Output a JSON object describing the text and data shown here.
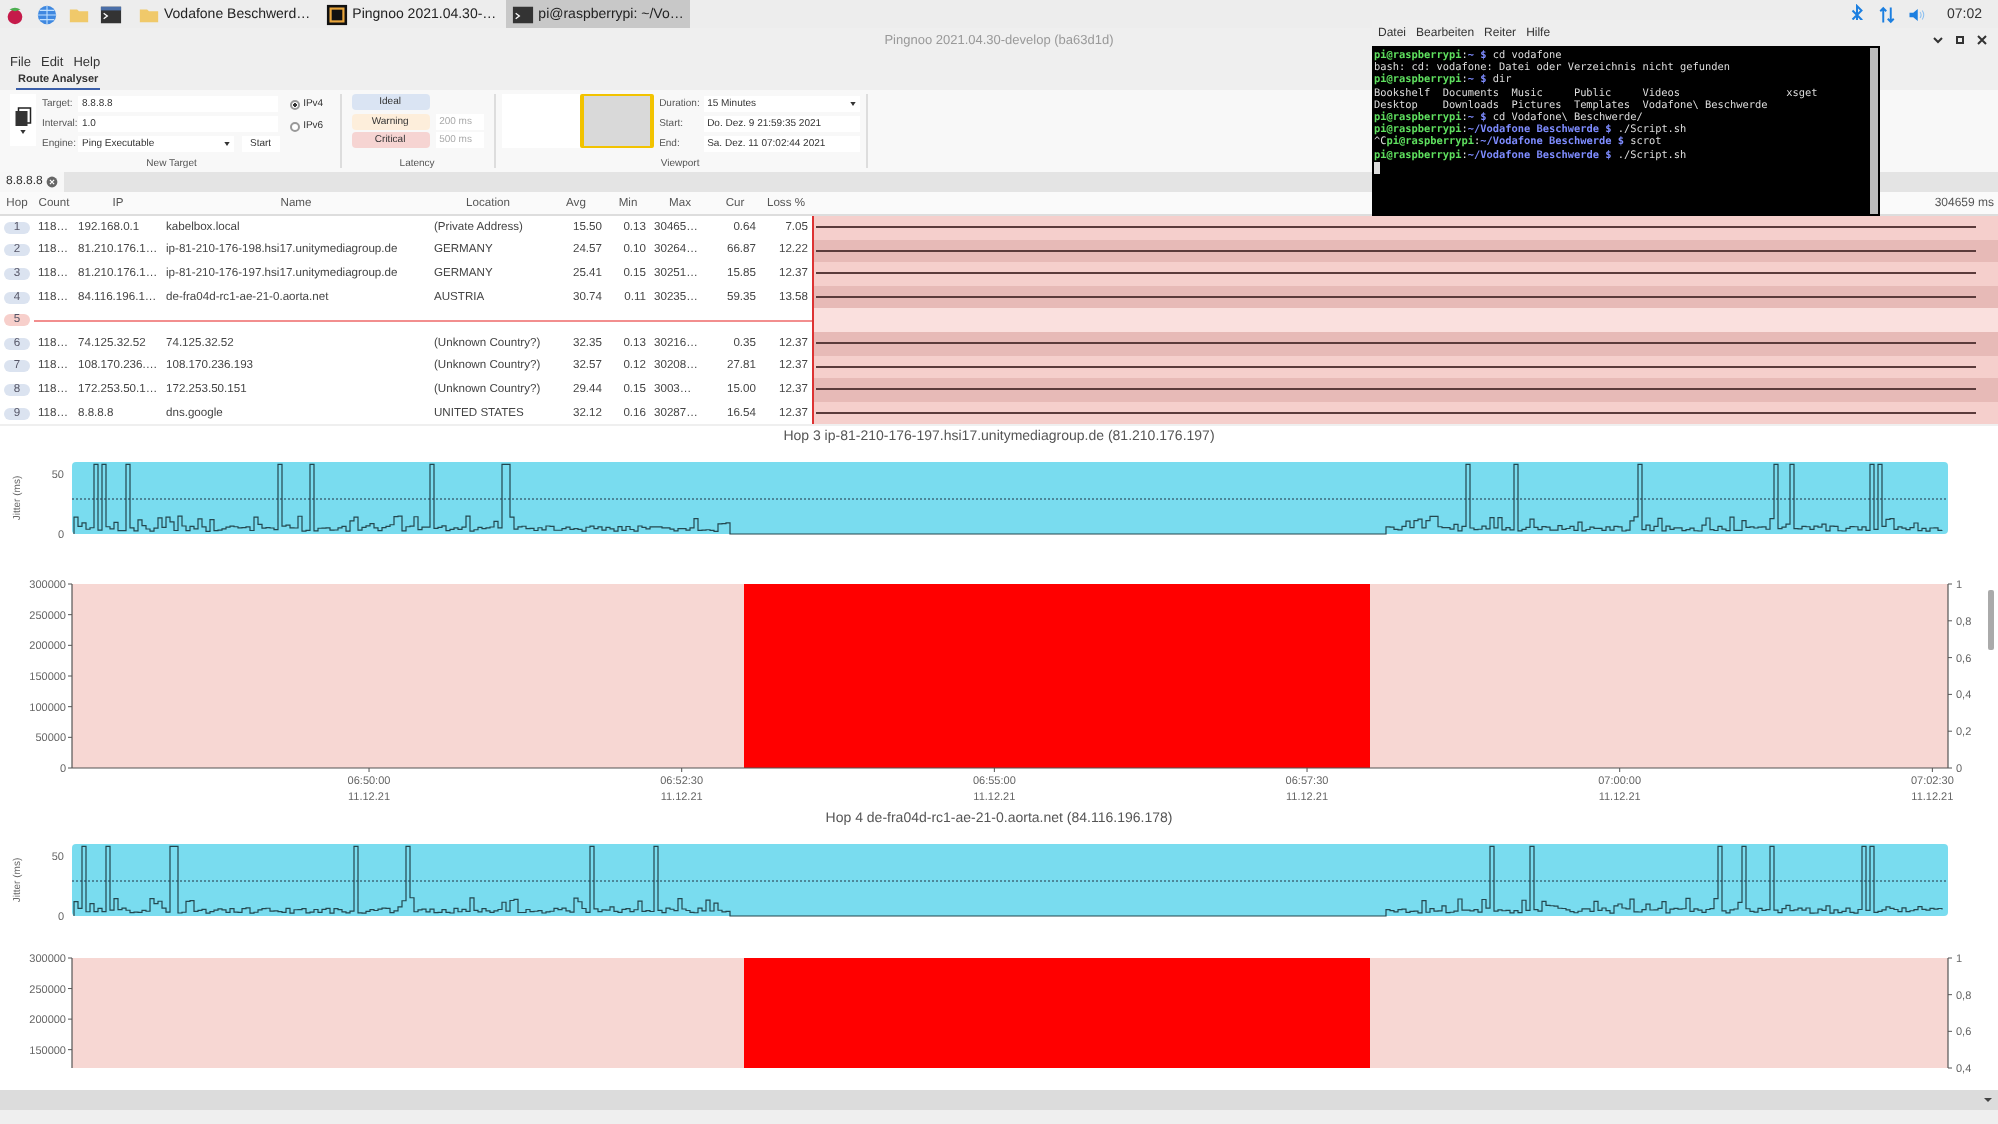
{
  "taskbar": {
    "tasks": [
      {
        "kind": "folder",
        "label": "Vodafone Beschwerd…",
        "selected": false
      },
      {
        "kind": "app",
        "label": "Pingnoo 2021.04.30-…",
        "selected": false
      },
      {
        "kind": "terminal",
        "label": "pi@raspberrypi: ~/Vo…",
        "selected": true
      }
    ],
    "clock": "07:02"
  },
  "window": {
    "title": "Pingnoo 2021.04.30-develop (ba63d1d)"
  },
  "menu": [
    "File",
    "Edit",
    "Help"
  ],
  "ribbon": {
    "tabs": [
      {
        "label": "Route Analyser",
        "selected": true
      }
    ],
    "new_target": {
      "target_label": "Target:",
      "target": "8.8.8.8",
      "interval_label": "Interval:",
      "interval": "1.0",
      "engine_label": "Engine:",
      "engine": "Ping Executable",
      "start": "Start",
      "caption": "New Target",
      "protocols": [
        {
          "label": "IPv4",
          "selected": true
        },
        {
          "label": "IPv6",
          "selected": false
        }
      ]
    },
    "latency": {
      "caption": "Latency",
      "levels": [
        {
          "label": "Ideal",
          "color": "#dae4f3"
        },
        {
          "label": "Warning",
          "color": "#fdeedb",
          "value": "200 ms"
        },
        {
          "label": "Critical",
          "color": "#f6d4d2",
          "value": "500 ms"
        }
      ]
    },
    "viewport": {
      "caption": "Viewport",
      "duration_label": "Duration:",
      "duration": "15 Minutes",
      "start_label": "Start:",
      "start": "Do. Dez. 9 21:59:35 2021",
      "end_label": "End:",
      "end": "Sa. Dez. 11 07:02:44 2021"
    }
  },
  "document_tabs": [
    {
      "label": "8.8.8.8",
      "selected": true
    }
  ],
  "table": {
    "columns": [
      "Hop",
      "Count",
      "IP",
      "Name",
      "Location",
      "Avg",
      "Min",
      "Max",
      "Cur",
      "Loss %"
    ],
    "timeline_scale": "304659 ms",
    "rows": [
      {
        "hop": "1",
        "responding": true,
        "cells": [
          "118…",
          "192.168.0.1",
          "kabelbox.local",
          "(Private Address)",
          "15.50",
          "0.13",
          "30465…",
          "0.64",
          "7.05"
        ]
      },
      {
        "hop": "2",
        "responding": true,
        "cells": [
          "118…",
          "81.210.176.1…",
          "ip-81-210-176-198.hsi17.unitymediagroup.de",
          "GERMANY",
          "24.57",
          "0.10",
          "30264…",
          "66.87",
          "12.22"
        ]
      },
      {
        "hop": "3",
        "responding": true,
        "cells": [
          "118…",
          "81.210.176.1…",
          "ip-81-210-176-197.hsi17.unitymediagroup.de",
          "GERMANY",
          "25.41",
          "0.15",
          "30251…",
          "15.85",
          "12.37"
        ]
      },
      {
        "hop": "4",
        "responding": true,
        "cells": [
          "118…",
          "84.116.196.1…",
          "de-fra04d-rc1-ae-21-0.aorta.net",
          "AUSTRIA",
          "30.74",
          "0.11",
          "30235…",
          "59.35",
          "13.58"
        ]
      },
      {
        "hop": "5",
        "responding": false
      },
      {
        "hop": "6",
        "responding": true,
        "cells": [
          "118…",
          "74.125.32.52",
          "74.125.32.52",
          "(Unknown Country?)",
          "32.35",
          "0.13",
          "30216…",
          "0.35",
          "12.37"
        ]
      },
      {
        "hop": "7",
        "responding": true,
        "cells": [
          "118…",
          "108.170.236.…",
          "108.170.236.193",
          "(Unknown Country?)",
          "32.57",
          "0.12",
          "30208…",
          "27.81",
          "12.37"
        ]
      },
      {
        "hop": "8",
        "responding": true,
        "cells": [
          "118…",
          "172.253.50.1…",
          "172.253.50.151",
          "(Unknown Country?)",
          "29.44",
          "0.15",
          "3003…",
          "15.00",
          "12.37"
        ]
      },
      {
        "hop": "9",
        "responding": true,
        "cells": [
          "118…",
          "8.8.8.8",
          "dns.google",
          "UNITED STATES",
          "32.12",
          "0.16",
          "30287…",
          "16.54",
          "12.37"
        ]
      }
    ]
  },
  "graphs": [
    {
      "title": "Hop 3 ip-81-210-176-197.hsi17.unitymediagroup.de (81.210.176.197)",
      "jitter": {
        "ylabel": "Jitter (ms)",
        "yticks": [
          "50",
          "0"
        ]
      },
      "chart_data": {
        "type": "area",
        "categories": [
          null,
          null,
          null,
          null,
          null,
          null,
          null,
          null,
          null,
          "06:50:00 11.12.21",
          null,
          null,
          null,
          null,
          null,
          null,
          null,
          null,
          null,
          "06:52:30 11.12.21",
          null,
          null,
          null,
          null,
          null,
          null,
          null,
          null,
          null,
          "06:55:00 11.12.21",
          null,
          null,
          null,
          null,
          null,
          null,
          null,
          null,
          null,
          "06:57:30 11.12.21",
          null,
          null,
          null,
          null,
          null,
          null,
          null,
          null,
          null,
          "07:00:00 11.12.21",
          null,
          null,
          null,
          null,
          null,
          null,
          null,
          null,
          null,
          "07:02:30 11.12.21"
        ],
        "series": [
          {
            "color": "#ff0000",
            "values": [
              null,
              null,
              null,
              null,
              null,
              null,
              null,
              null,
              null,
              null,
              null,
              null,
              null,
              null,
              null,
              null,
              null,
              null,
              null,
              null,
              null,
              300000,
              300000,
              300000,
              300000,
              300000,
              300000,
              300000,
              300000,
              300000,
              300000,
              300000,
              300000,
              300000,
              300000,
              300000,
              300000,
              300000,
              300000,
              300000,
              300000,
              300000,
              null,
              null,
              null,
              null,
              null,
              null,
              null,
              null,
              null,
              null,
              null,
              null,
              null,
              null,
              null,
              null,
              null,
              null
            ]
          }
        ],
        "ylim": [
          0,
          300000
        ],
        "yticks": [
          0,
          50000,
          100000,
          150000,
          200000,
          250000,
          300000
        ],
        "y2lim": [
          0,
          1
        ],
        "y2ticks": [
          {
            "value": 0,
            "label": "0"
          },
          {
            "value": 0.2,
            "label": "0,2"
          },
          {
            "value": 0.4,
            "label": "0,4"
          },
          {
            "value": 0.6,
            "label": "0,6"
          },
          {
            "value": 0.8,
            "label": "0,8"
          },
          {
            "value": 1,
            "label": "1"
          }
        ]
      }
    },
    {
      "title": "Hop 4 de-fra04d-rc1-ae-21-0.aorta.net (84.116.196.178)",
      "jitter": {
        "ylabel": "Jitter (ms)",
        "yticks": [
          "50",
          "0"
        ]
      },
      "chart_data": {
        "type": "area",
        "categories": [
          null,
          null,
          null,
          null,
          null,
          null,
          null,
          null,
          null,
          null,
          null,
          null,
          null,
          null,
          null,
          null,
          null,
          null,
          null,
          null,
          null,
          null,
          null,
          null,
          null,
          null,
          null,
          null,
          null,
          null,
          null,
          null,
          null,
          null,
          null,
          null,
          null,
          null,
          null,
          null,
          null,
          null,
          null,
          null,
          null,
          null,
          null,
          null,
          null,
          null,
          null,
          null,
          null,
          null,
          null,
          null,
          null,
          null,
          null,
          null
        ],
        "series": [
          {
            "color": "#ff0000",
            "values": [
              null,
              null,
              null,
              null,
              null,
              null,
              null,
              null,
              null,
              null,
              null,
              null,
              null,
              null,
              null,
              null,
              null,
              null,
              null,
              null,
              null,
              300000,
              300000,
              300000,
              300000,
              300000,
              300000,
              300000,
              300000,
              300000,
              300000,
              300000,
              300000,
              300000,
              300000,
              300000,
              300000,
              300000,
              300000,
              300000,
              300000,
              300000,
              null,
              null,
              null,
              null,
              null,
              null,
              null,
              null,
              null,
              null,
              null,
              null,
              null,
              null,
              null,
              null,
              null,
              null
            ]
          }
        ],
        "ylim": [
          120000,
          300000
        ],
        "yticks": [
          150000,
          200000,
          250000,
          300000
        ],
        "y2lim": [
          0.4,
          1
        ],
        "y2ticks": [
          {
            "value": 0.4,
            "label": "0,4"
          },
          {
            "value": 0.6,
            "label": "0,6"
          },
          {
            "value": 0.8,
            "label": "0,8"
          },
          {
            "value": 1,
            "label": "1"
          }
        ]
      }
    }
  ],
  "terminal": {
    "menu": [
      "Datei",
      "Bearbeiten",
      "Reiter",
      "Hilfe"
    ],
    "lines": [
      [
        {
          "kind": "user",
          "text": "pi@raspberrypi"
        },
        {
          "kind": "text",
          "text": ":"
        },
        {
          "kind": "path",
          "text": "~ $"
        },
        {
          "kind": "text",
          "text": " cd vodafone"
        }
      ],
      [
        {
          "kind": "text",
          "text": "bash: cd: vodafone: Datei oder Verzeichnis nicht gefunden"
        }
      ],
      [
        {
          "kind": "user",
          "text": "pi@raspberrypi"
        },
        {
          "kind": "text",
          "text": ":"
        },
        {
          "kind": "path",
          "text": "~ $"
        },
        {
          "kind": "text",
          "text": " dir"
        }
      ],
      [
        {
          "kind": "text",
          "text": "Bookshelf  Documents  Music     Public     Videos                 xsget"
        }
      ],
      [
        {
          "kind": "text",
          "text": "Desktop    Downloads  Pictures  Templates  Vodafone\\ Beschwerde"
        }
      ],
      [
        {
          "kind": "user",
          "text": "pi@raspberrypi"
        },
        {
          "kind": "text",
          "text": ":"
        },
        {
          "kind": "path",
          "text": "~ $"
        },
        {
          "kind": "text",
          "text": " cd Vodafone\\ Beschwerde/"
        }
      ],
      [
        {
          "kind": "user",
          "text": "pi@raspberrypi"
        },
        {
          "kind": "text",
          "text": ":"
        },
        {
          "kind": "path",
          "text": "~/Vodafone Beschwerde $"
        },
        {
          "kind": "text",
          "text": " ./Script.sh"
        }
      ],
      [
        {
          "kind": "text",
          "text": "^C"
        },
        {
          "kind": "user",
          "text": "pi@raspberrypi"
        },
        {
          "kind": "text",
          "text": ":"
        },
        {
          "kind": "path",
          "text": "~/Vodafone Beschwerde $"
        },
        {
          "kind": "text",
          "text": " scrot"
        }
      ],
      [
        {
          "kind": "user",
          "text": "pi@raspberrypi"
        },
        {
          "kind": "text",
          "text": ":"
        },
        {
          "kind": "path",
          "text": "~/Vodafone Beschwerde $"
        },
        {
          "kind": "text",
          "text": " ./Script.sh"
        }
      ]
    ]
  }
}
